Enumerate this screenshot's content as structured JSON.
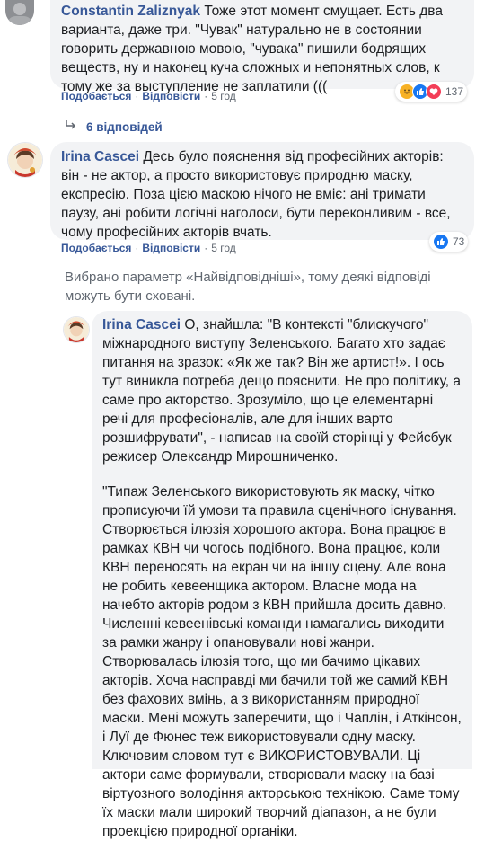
{
  "comment1": {
    "author": "Constantin Zaliznyak",
    "text": "Тоже этот момент смущает. Есть два варианта, даже три. \"Чувак\" натурально не в состоянии говорить державною мовою, \"чувака\" пишили бодрящих веществ, ну и наконец куча сложных и непонятных слов, к тому же за выступление не заплатили (((",
    "like_label": "Подобається",
    "reply_label": "Відповісти",
    "time": "5 год",
    "reaction_count": "137",
    "reaction_icons": [
      "haha-icon",
      "like-icon",
      "love-icon"
    ]
  },
  "replies_toggle": {
    "label": "6 відповідей"
  },
  "comment2": {
    "author": "Irina Cascei",
    "text": "Десь було пояснення від професійних акторів: він - не актор, а просто використовує природню маску, експресію. Поза цією маскою нічого не вміє: ані тримати паузу, ані робити логічні наголоси, бути переконливим - все, чому професійних акторів вчать.",
    "like_label": "Подобається",
    "reply_label": "Відповісти",
    "time": "5 год",
    "reaction_count": "73",
    "reaction_icons": [
      "like-icon"
    ]
  },
  "filter_notice": "Вибрано параметр «Найвідповідніші», тому деякі відповіді можуть бути сховані.",
  "reply1": {
    "author": "Irina Cascei",
    "paragraph1": "О, знайшла: \"В контексті \"блискучого\" міжнародного виступу Зеленського. Багато хто задає питання на зразок: «Як же так? Він же артист!». І ось тут виникла потреба дещо пояснити. Не про політику, а саме про акторство. Зрозуміло, що це елементарні речі для професіоналів, але для інших варто розшифрувати\", - написав на своїй сторінці у Фейсбук режисер Олександр Мирошниченко.",
    "paragraph2": "\"Типаж Зеленського використовують як маску, чітко прописуючи їй умови та правила сценічного існування. Створюється ілюзія хорошого актора. Вона працює в рамках КВН чи чогось подібного. Вона працює, коли КВН переносять на екран чи на іншу сцену. Але вона не робить кевеенщика актором. Власне мода на начебто акторів родом з КВН прийшла досить давно. Численні кевеенівські команди намагались виходити за рамки жанру і опановували нові жанри. Створювалась ілюзія того, що ми бачимо цікавих акторів. Хоча насправді ми бачили той же самий КВН без фахових вмінь, а з використанням природної маски. Мені можуть заперечити, що і Чаплін, і Аткінсон, і Луї де Фюнес теж використовували одну маску. Ключовим словом тут є ВИКОРИСТОВУВАЛИ. Ці актори саме формували, створювали маску на базі віртуозного володіння акторською технікою. Саме тому їх маски мали широкий творчий діапазон, а не були проекцією природної органіки."
  },
  "colors": {
    "bubble": "#f2f3f5",
    "author": "#385898",
    "meta": "#606770",
    "like": "#1877f2",
    "love": "#f33e58",
    "haha": "#f7b125"
  }
}
